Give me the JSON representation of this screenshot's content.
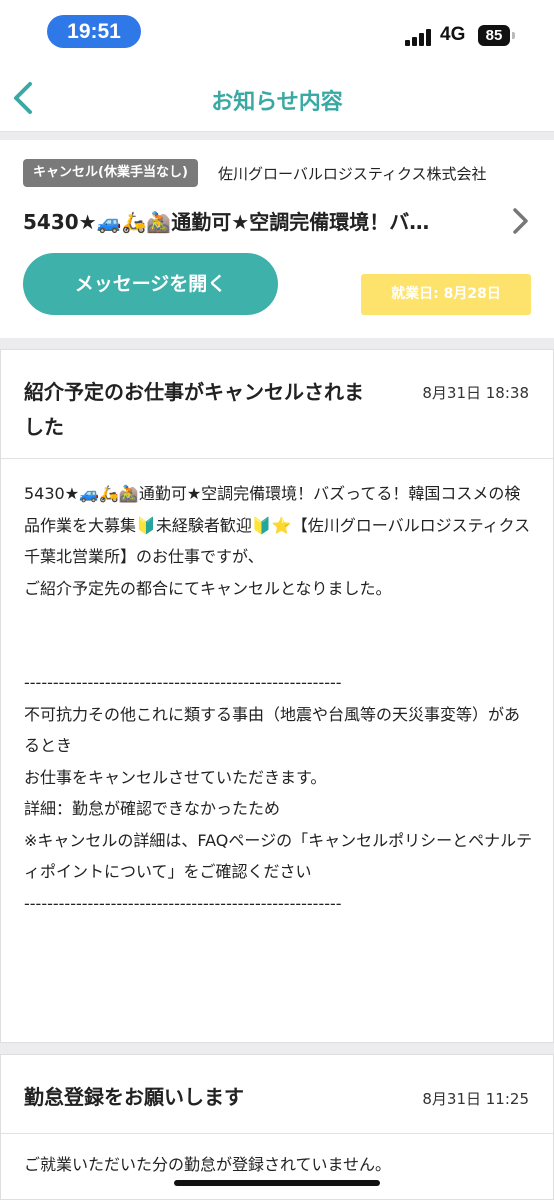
{
  "status_bar": {
    "time": "19:51",
    "network": "4G",
    "battery": "85"
  },
  "header": {
    "title": "お知らせ内容",
    "accent_color": "#3aa9a4"
  },
  "job": {
    "status_tag": "キャンセル(休業手当なし)",
    "company": "佐川グローバルロジスティクス株式会社",
    "title": "5430★🚙🛵🚵通勤可★空調完備環境！バ…",
    "message_button": "メッセージを開く",
    "work_date": "就業日: 8月28日"
  },
  "notices": [
    {
      "title": "紹介予定のお仕事がキャンセルされました",
      "date": "8月31日 18:38",
      "body": "5430★🚙🛵🚵通勤可★空調完備環境！バズってる！韓国コスメの検品作業を大募集🔰未経験者歓迎🔰⭐【佐川グローバルロジスティクス千葉北営業所】のお仕事ですが、\nご紹介予定先の都合にてキャンセルとなりました。\n\n\n-------------------------------------------------------\n不可抗力その他これに類する事由（地震や台風等の天災事変等）があるとき\nお仕事をキャンセルさせていただきます。\n詳細：勤怠が確認できなかったため\n※キャンセルの詳細は、FAQページの「キャンセルポリシーとペナルティポイントについて」をご確認ください\n-------------------------------------------------------"
    },
    {
      "title": "勤怠登録をお願いします",
      "date": "8月31日 11:25",
      "body": "ご就業いただいた分の勤怠が登録されていません。"
    }
  ]
}
